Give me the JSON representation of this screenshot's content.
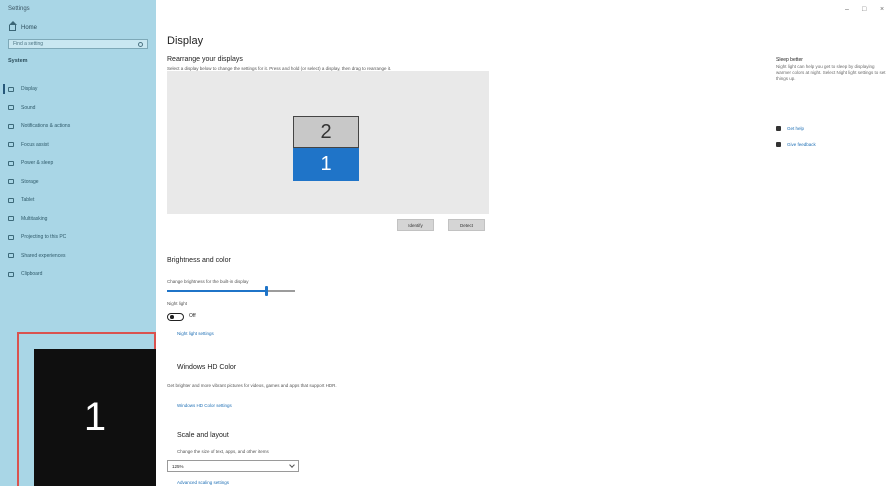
{
  "window": {
    "title": "Settings",
    "controls": {
      "minimize": "–",
      "maximize": "□",
      "close": "×"
    }
  },
  "sidebar": {
    "home": "Home",
    "search_placeholder": "Find a setting",
    "section": "System",
    "items": [
      {
        "label": "Display",
        "icon": "display-icon",
        "active": true
      },
      {
        "label": "Sound",
        "icon": "sound-icon"
      },
      {
        "label": "Notifications & actions",
        "icon": "notifications-icon"
      },
      {
        "label": "Focus assist",
        "icon": "focus-assist-icon"
      },
      {
        "label": "Power & sleep",
        "icon": "power-icon"
      },
      {
        "label": "Storage",
        "icon": "storage-icon"
      },
      {
        "label": "Tablet",
        "icon": "tablet-icon"
      },
      {
        "label": "Multitasking",
        "icon": "multitasking-icon"
      },
      {
        "label": "Projecting to this PC",
        "icon": "projecting-icon"
      },
      {
        "label": "Shared experiences",
        "icon": "shared-icon"
      },
      {
        "label": "Clipboard",
        "icon": "clipboard-icon"
      }
    ]
  },
  "identify_overlay": {
    "number": "1"
  },
  "main": {
    "title": "Display",
    "rearrange": {
      "heading": "Rearrange your displays",
      "description": "Select a display below to change the settings for it. Press and hold (or select) a display, then drag to rearrange it.",
      "monitor_2": "2",
      "monitor_1": "1",
      "identify_button": "Identify",
      "detect_button": "Detect"
    },
    "brightness": {
      "heading": "Brightness and color",
      "label": "Change brightness for the built-in display",
      "level_percent": 78,
      "night_light_label": "Night light",
      "night_light_state": "Off",
      "night_light_link": "Night light settings"
    },
    "hdr": {
      "heading": "Windows HD Color",
      "description": "Get brighter and more vibrant pictures for videos, games and apps that support HDR.",
      "link": "Windows HD Color settings"
    },
    "scale": {
      "heading": "Scale and layout",
      "label": "Change the size of text, apps, and other items",
      "value": "125%",
      "link": "Advanced scaling settings"
    }
  },
  "right": {
    "title": "Sleep better",
    "description": "Night light can help you get to sleep by displaying warmer colors at night. Select Night light settings to set things up.",
    "help_link": "Get help",
    "feedback_link": "Give feedback"
  }
}
